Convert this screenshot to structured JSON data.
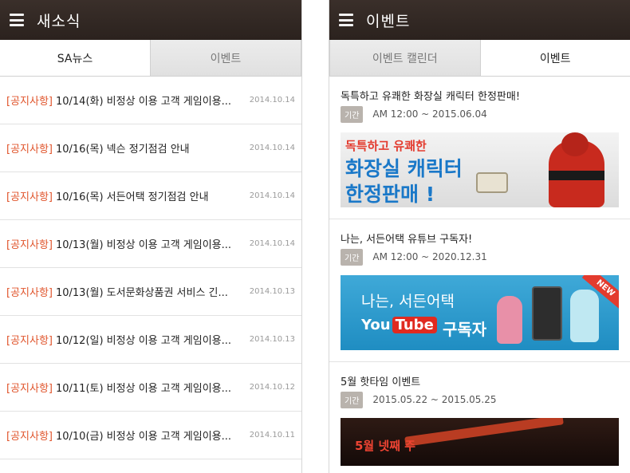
{
  "left": {
    "title": "새소식",
    "tabs": [
      {
        "label": "SA뉴스"
      },
      {
        "label": "이벤트"
      }
    ],
    "news": [
      {
        "tag": "[공지사항]",
        "title": "10/14(화) 비정상 이용 고객 게임이용...",
        "date": "2014.10.14"
      },
      {
        "tag": "[공지사항]",
        "title": "10/16(목) 넥슨 정기점검 안내",
        "date": "2014.10.14"
      },
      {
        "tag": "[공지사항]",
        "title": "10/16(목) 서든어택 정기점검 안내",
        "date": "2014.10.14"
      },
      {
        "tag": "[공지사항]",
        "title": "10/13(월) 비정상 이용 고객 게임이용...",
        "date": "2014.10.14"
      },
      {
        "tag": "[공지사항]",
        "title": "10/13(월) 도서문화상품권 서비스 긴...",
        "date": "2014.10.13"
      },
      {
        "tag": "[공지사항]",
        "title": "10/12(일) 비정상 이용 고객 게임이용...",
        "date": "2014.10.13"
      },
      {
        "tag": "[공지사항]",
        "title": "10/11(토) 비정상 이용 고객 게임이용...",
        "date": "2014.10.12"
      },
      {
        "tag": "[공지사항]",
        "title": "10/10(금) 비정상 이용 고객 게임이용...",
        "date": "2014.10.11"
      }
    ]
  },
  "right": {
    "title": "이벤트",
    "tabs": [
      {
        "label": "이벤트 캘린더"
      },
      {
        "label": "이벤트"
      }
    ],
    "events": [
      {
        "title": "독특하고 유쾌한 화장실 캐릭터 한정판매!",
        "badge": "기간",
        "period": "AM 12:00 ~ 2015.06.04",
        "banner": {
          "line1": "독특하고 유쾌한",
          "line2": "화장실 캐릭터",
          "line3": "한정판매 !"
        }
      },
      {
        "title": "나는, 서든어택 유튜브 구독자!",
        "badge": "기간",
        "period": "AM 12:00 ~ 2020.12.31",
        "banner": {
          "line1": "나는, 서든어택",
          "you": "You",
          "tube": "Tube",
          "sub": "구독자",
          "new": "NEW"
        }
      },
      {
        "title": "5월 핫타임 이벤트",
        "badge": "기간",
        "period": "2015.05.22 ~ 2015.05.25",
        "banner": {
          "line1": "5월 넷째 주"
        }
      }
    ]
  },
  "colors": {
    "appbar": "#2b221e",
    "notice_tag": "#e0542b",
    "badge": "#b9b3ad"
  }
}
